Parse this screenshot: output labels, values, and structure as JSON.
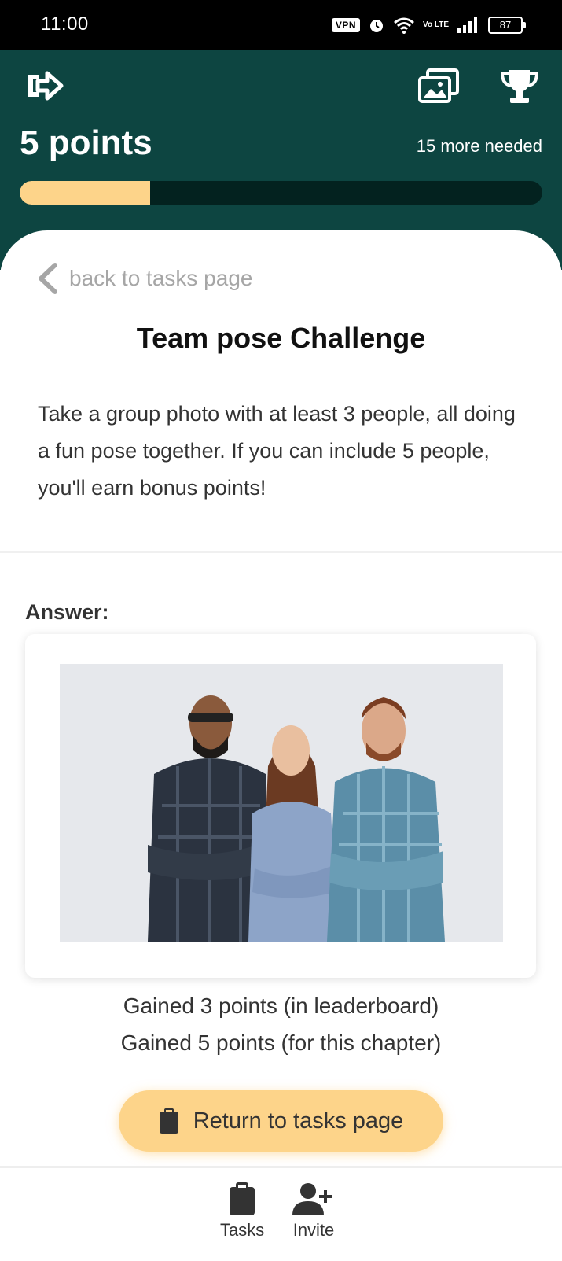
{
  "status_bar": {
    "time": "11:00",
    "vpn": "VPN",
    "volte": "Vo LTE",
    "battery": "87"
  },
  "header": {
    "points_label": "5 points",
    "more_needed": "15 more needed",
    "progress_fraction": 0.25,
    "colors": {
      "background": "#0d4541",
      "progress_fill": "#fdd48a",
      "progress_track": "#03221f"
    },
    "icons": [
      "logout-icon",
      "gallery-icon",
      "trophy-icon"
    ]
  },
  "task": {
    "back_label": "back to tasks page",
    "title": "Team pose Challenge",
    "description": "Take a group photo with at least 3 people, all doing a fun pose together. If you can include 5 people, you'll earn bonus points!",
    "answer_label": "Answer:",
    "gained_leaderboard": "Gained 3 points (in leaderboard)",
    "gained_chapter": "Gained 5 points (for this chapter)",
    "return_button": "Return to tasks page"
  },
  "bottom_nav": {
    "items": [
      {
        "label": "Tasks",
        "icon": "clipboard-icon"
      },
      {
        "label": "Invite",
        "icon": "add-user-icon"
      }
    ]
  }
}
